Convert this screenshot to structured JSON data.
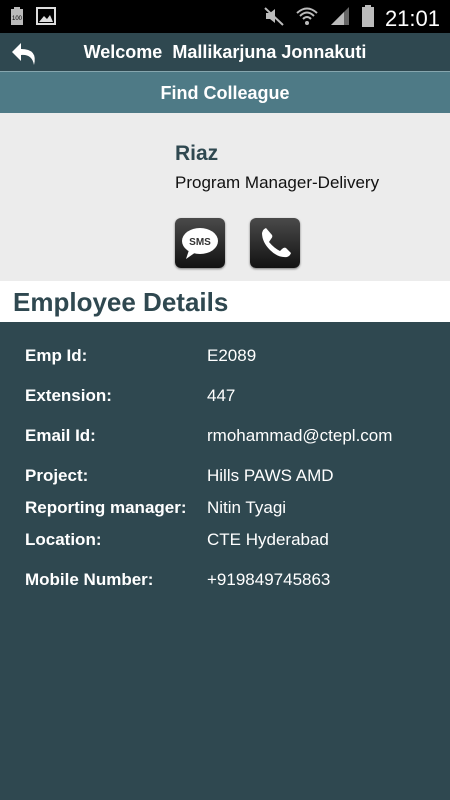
{
  "status_bar": {
    "time": "21:01",
    "battery_level_badge": "100",
    "icons": [
      "battery-full-icon",
      "image-icon",
      "mute-icon",
      "wifi-icon",
      "signal-icon",
      "battery-icon"
    ]
  },
  "header": {
    "welcome_text": "Welcome  Mallikarjuna Jonnakuti",
    "back_icon": "back-arrow-icon"
  },
  "title_bar": {
    "title": "Find Colleague"
  },
  "profile": {
    "name": "Riaz",
    "designation": "Program Manager-Delivery",
    "sms_label": "SMS"
  },
  "section": {
    "title": "Employee Details"
  },
  "details": [
    {
      "label": "Emp Id:",
      "value": "E2089"
    },
    {
      "label": "Extension:",
      "value": "447"
    },
    {
      "label": "Email Id:",
      "value": "rmohammad@ctepl.com"
    },
    {
      "label": "Project:",
      "value": "Hills PAWS AMD"
    },
    {
      "label": "Reporting manager:",
      "value": "Nitin Tyagi"
    },
    {
      "label": "Location:",
      "value": "CTE Hyderabad"
    },
    {
      "label": "Mobile Number:",
      "value": "+919849745863"
    }
  ],
  "colors": {
    "primary": "#2f4850",
    "accent_bar": "#4e7a86",
    "card_bg": "#ececec"
  }
}
